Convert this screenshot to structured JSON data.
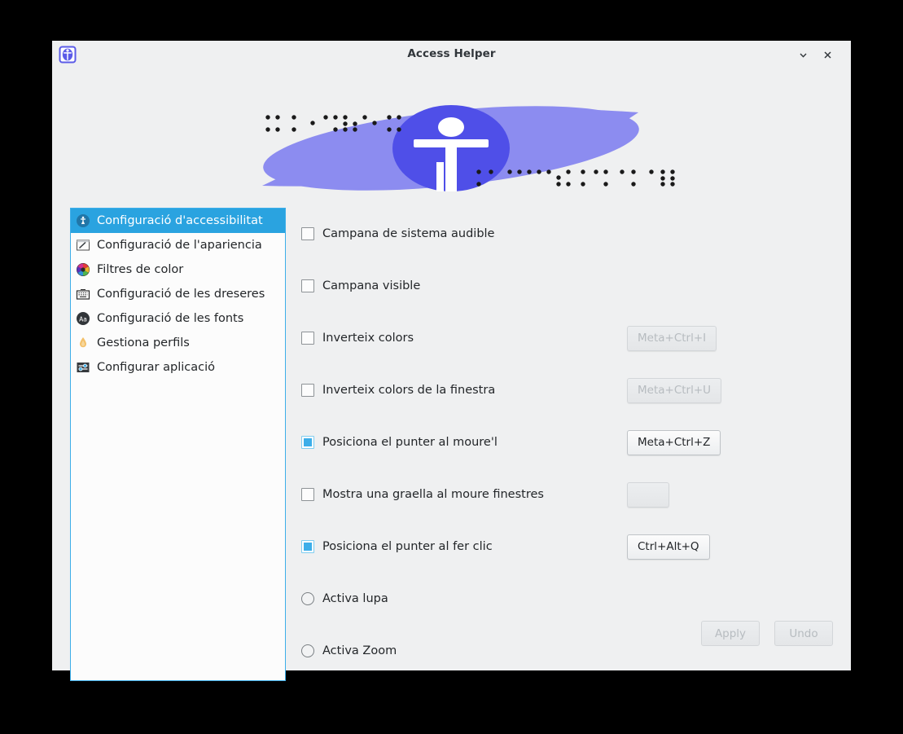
{
  "window": {
    "title": "Access Helper",
    "app_icon": "accessibility-person-icon",
    "minimize_icon": "chevron-down-icon",
    "close_icon": "close-icon",
    "background": "#eff0f1"
  },
  "banner": {
    "icon": "accessibility-person-banner-icon",
    "ellipse_color": "#8c8cf0",
    "circle_color": "#4f4fe8",
    "figure_color": "#ffffff",
    "braille_left": "braille-dots-left",
    "braille_right": "braille-dots-right"
  },
  "sidebar": {
    "border_color": "#3daee9",
    "selected_background": "#2aa3e0",
    "items": [
      {
        "label": "Configuració d'accessibilitat",
        "icon": "accessibility-icon",
        "selected": true
      },
      {
        "label": "Configuració de l'apariencia",
        "icon": "appearance-pencil-icon",
        "selected": false
      },
      {
        "label": "Filtres de color",
        "icon": "color-wheel-icon",
        "selected": false
      },
      {
        "label": "Configuració de les dreseres",
        "icon": "keyboard-icon",
        "selected": false
      },
      {
        "label": "Configuració de les fonts",
        "icon": "font-aa-icon",
        "selected": false
      },
      {
        "label": "Gestiona perfils",
        "icon": "flame-droplet-icon",
        "selected": false
      },
      {
        "label": "Configurar aplicació",
        "icon": "sliders-icon",
        "selected": false
      }
    ]
  },
  "options": [
    {
      "type": "checkbox",
      "label": "Campana de sistema audible",
      "checked": false,
      "shortcut": null,
      "shortcut_disabled": true
    },
    {
      "type": "checkbox",
      "label": "Campana visible",
      "checked": false,
      "shortcut": null,
      "shortcut_disabled": true
    },
    {
      "type": "checkbox",
      "label": "Inverteix colors",
      "checked": false,
      "shortcut": "Meta+Ctrl+I",
      "shortcut_disabled": true
    },
    {
      "type": "checkbox",
      "label": "Inverteix colors de la finestra",
      "checked": false,
      "shortcut": "Meta+Ctrl+U",
      "shortcut_disabled": true
    },
    {
      "type": "checkbox",
      "label": "Posiciona el punter al moure'l",
      "checked": true,
      "shortcut": "Meta+Ctrl+Z",
      "shortcut_disabled": false
    },
    {
      "type": "checkbox",
      "label": "Mostra una graella al moure finestres",
      "checked": false,
      "shortcut": "",
      "shortcut_disabled": true
    },
    {
      "type": "checkbox",
      "label": "Posiciona el punter al fer clic",
      "checked": true,
      "shortcut": "Ctrl+Alt+Q",
      "shortcut_disabled": false
    },
    {
      "type": "radio",
      "label": "Activa lupa",
      "checked": false,
      "shortcut": null,
      "shortcut_disabled": true
    },
    {
      "type": "radio",
      "label": "Activa Zoom",
      "checked": false,
      "shortcut": null,
      "shortcut_disabled": true
    }
  ],
  "footer": {
    "apply_label": "Apply",
    "apply_disabled": true,
    "undo_label": "Undo",
    "undo_disabled": true
  }
}
